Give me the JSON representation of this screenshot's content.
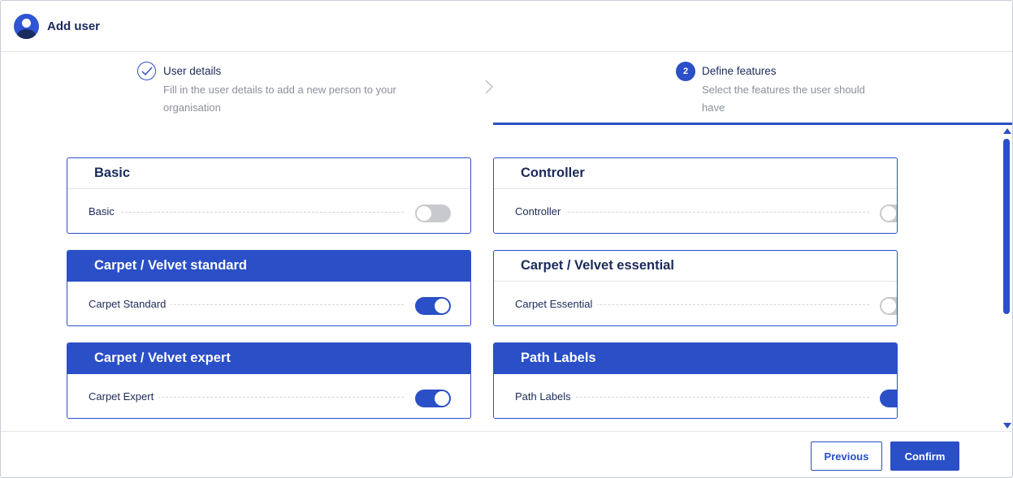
{
  "header": {
    "title": "Add user",
    "icon": "user-avatar-icon"
  },
  "stepper": {
    "steps": [
      {
        "title": "User details",
        "description": "Fill in the user details to add a new person to your organisation",
        "status": "completed"
      },
      {
        "number": "2",
        "title": "Define features",
        "description": "Select the features the user should have",
        "status": "active"
      }
    ]
  },
  "features": [
    {
      "title": "Basic",
      "label": "Basic",
      "enabled": false
    },
    {
      "title": "Controller",
      "label": "Controller",
      "enabled": false
    },
    {
      "title": "Carpet / Velvet standard",
      "label": "Carpet Standard",
      "enabled": true
    },
    {
      "title": "Carpet / Velvet essential",
      "label": "Carpet Essential",
      "enabled": false
    },
    {
      "title": "Carpet / Velvet expert",
      "label": "Carpet Expert",
      "enabled": true
    },
    {
      "title": "Path Labels",
      "label": "Path Labels",
      "enabled": true
    }
  ],
  "footer": {
    "previous_label": "Previous",
    "confirm_label": "Confirm"
  },
  "colors": {
    "accent": "#2b4fc7",
    "text": "#1c2a5a",
    "toggle_off": "#c8c9cc"
  }
}
